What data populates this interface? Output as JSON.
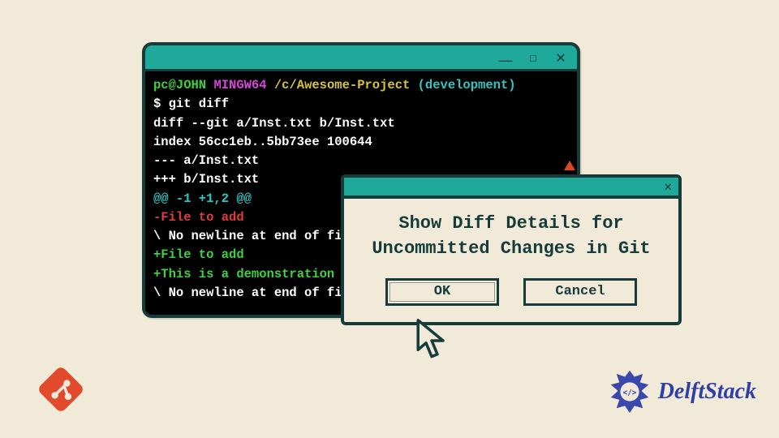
{
  "terminal": {
    "prompt": {
      "user": "pc@JOHN",
      "env": "MINGW64",
      "path": "/c/Awesome-Project",
      "branch": "(development)"
    },
    "command": "$ git diff",
    "lines": [
      {
        "text": "diff --git a/Inst.txt b/Inst.txt",
        "cls": "c-white"
      },
      {
        "text": "index 56cc1eb..5bb73ee 100644",
        "cls": "c-white"
      },
      {
        "text": "--- a/Inst.txt",
        "cls": "c-white"
      },
      {
        "text": "+++ b/Inst.txt",
        "cls": "c-white"
      },
      {
        "text": "@@ -1 +1,2 @@",
        "cls": "c-cyan"
      },
      {
        "text": "-File to add",
        "cls": "c-red"
      },
      {
        "text": "\\ No newline at end of file",
        "cls": "c-white"
      },
      {
        "text": "+File to add",
        "cls": "c-green"
      },
      {
        "text": "+This is a demonstration for",
        "cls": "c-green"
      },
      {
        "text": "\\ No newline at end of file",
        "cls": "c-white"
      }
    ]
  },
  "dialog": {
    "title_line1": "Show Diff Details for",
    "title_line2": "Uncommitted Changes in Git",
    "ok_label": "OK",
    "cancel_label": "Cancel"
  },
  "branding": {
    "delft": "DelftStack"
  }
}
